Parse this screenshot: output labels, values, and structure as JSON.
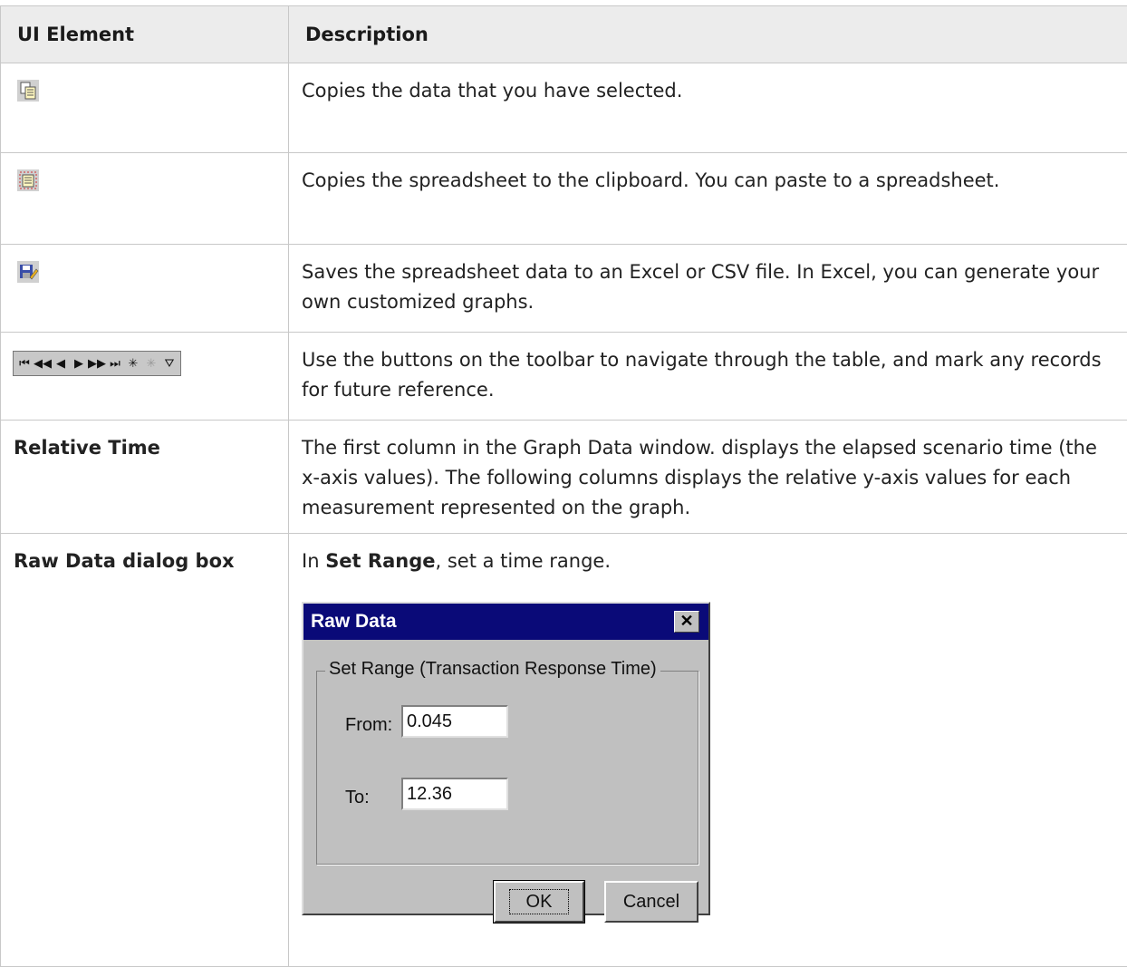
{
  "table": {
    "headers": [
      "UI Element",
      "Description"
    ],
    "rows": [
      {
        "element_icon": "copy-icon",
        "description": "Copies the data that you have selected."
      },
      {
        "element_icon": "copy-spreadsheet-icon",
        "description": "Copies the spreadsheet to the clipboard. You can paste to a spreadsheet."
      },
      {
        "element_icon": "save-icon",
        "description": "Saves the spreadsheet data to an Excel or CSV file. In Excel, you can generate your own customized graphs."
      },
      {
        "element_icon": "navigation-toolbar",
        "description": "Use the buttons on the toolbar to navigate through the table, and mark any records for future reference."
      },
      {
        "element": "Relative Time",
        "description": "The first column in the Graph Data window. displays the elapsed scenario time (the x-axis values). The following columns displays the relative y-axis values for each measurement represented on the graph."
      },
      {
        "element": "Raw Data dialog box",
        "description_pre": "In ",
        "description_bold": "Set Range",
        "description_post": ", set a time range."
      }
    ]
  },
  "toolbar": {
    "buttons": [
      "⏮",
      "◀◀",
      "◀",
      "▶",
      "▶▶",
      "⏭",
      "✳",
      "✳",
      "⛛"
    ]
  },
  "dialog": {
    "title": "Raw Data",
    "close": "✕",
    "group_label": "Set Range  (Transaction Response Time)",
    "from_label": "From:",
    "from_value": "0.045",
    "to_label": "To:",
    "to_value": "12.36",
    "ok_label": "OK",
    "cancel_label": "Cancel"
  }
}
